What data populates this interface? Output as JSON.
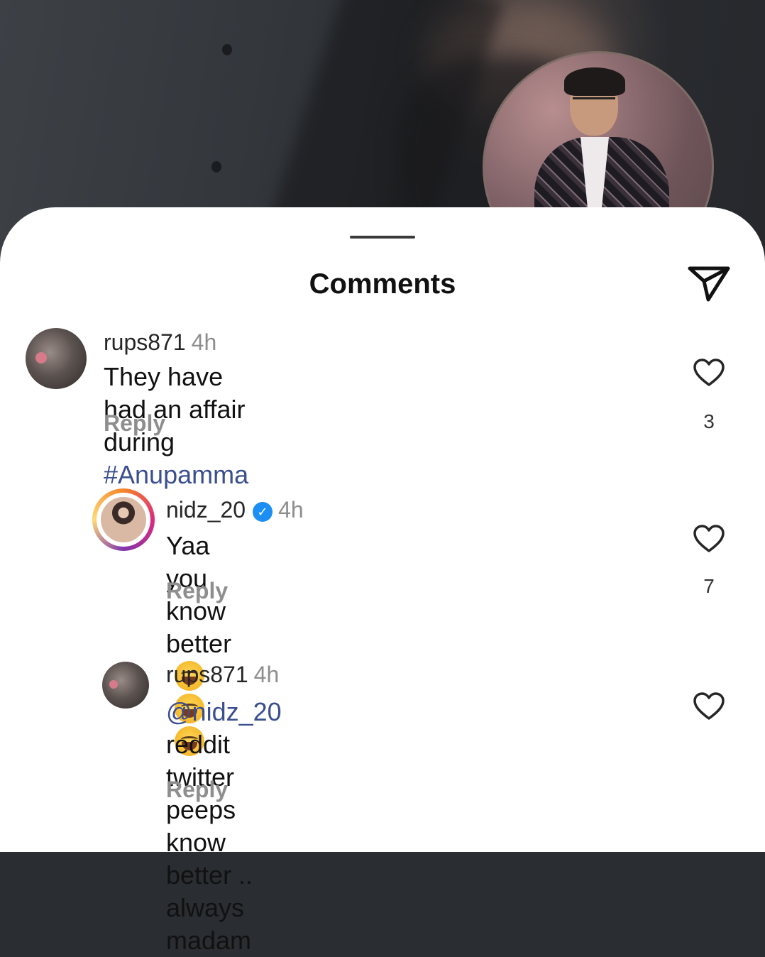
{
  "sheet": {
    "title": "Comments"
  },
  "comments": [
    {
      "username": "rups871",
      "time": "4h",
      "text": "They have had an affair during ",
      "hashtag": "#Anupamma",
      "reply_label": "Reply",
      "likes": "3"
    },
    {
      "username": "nidz_20",
      "verified": true,
      "time": "4h",
      "text": "Yaa you know better",
      "emojis": [
        "face-with-tears-of-joy",
        "face-with-tears-of-joy",
        "face-with-tears-of-joy"
      ],
      "reply_label": "Reply",
      "likes": "7"
    },
    {
      "username": "rups871",
      "time": "4h",
      "mention": "@nidz_20",
      "text_line1": " reddit twitter peeps know",
      "text_line2": "better .. always madam",
      "reply_label": "Reply"
    }
  ],
  "icons": {
    "send": "send-icon",
    "like": "heart-icon",
    "verified": "verified-badge-icon"
  },
  "colors": {
    "hashtag": "#3b4f8f",
    "verified": "#1c8ef4",
    "muted_text": "#8e8e8e"
  }
}
